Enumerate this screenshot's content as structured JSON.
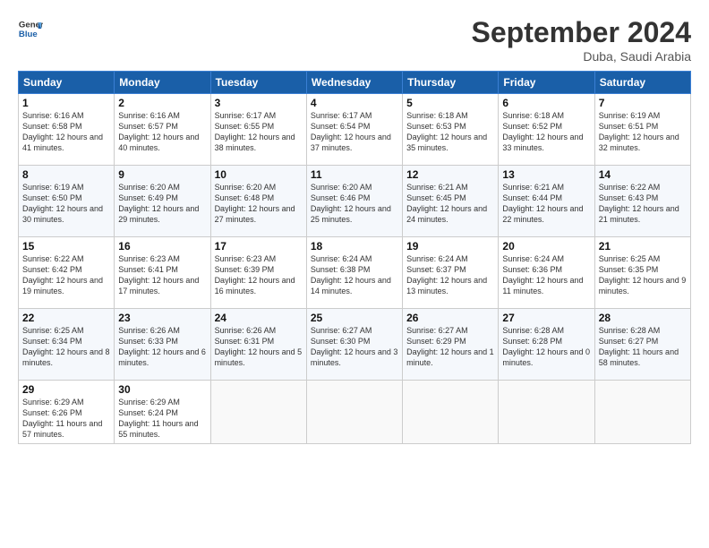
{
  "header": {
    "logo_line1": "General",
    "logo_line2": "Blue",
    "month": "September 2024",
    "location": "Duba, Saudi Arabia"
  },
  "days_of_week": [
    "Sunday",
    "Monday",
    "Tuesday",
    "Wednesday",
    "Thursday",
    "Friday",
    "Saturday"
  ],
  "weeks": [
    [
      {
        "day": "1",
        "sunrise": "6:16 AM",
        "sunset": "6:58 PM",
        "daylight": "12 hours and 41 minutes."
      },
      {
        "day": "2",
        "sunrise": "6:16 AM",
        "sunset": "6:57 PM",
        "daylight": "12 hours and 40 minutes."
      },
      {
        "day": "3",
        "sunrise": "6:17 AM",
        "sunset": "6:55 PM",
        "daylight": "12 hours and 38 minutes."
      },
      {
        "day": "4",
        "sunrise": "6:17 AM",
        "sunset": "6:54 PM",
        "daylight": "12 hours and 37 minutes."
      },
      {
        "day": "5",
        "sunrise": "6:18 AM",
        "sunset": "6:53 PM",
        "daylight": "12 hours and 35 minutes."
      },
      {
        "day": "6",
        "sunrise": "6:18 AM",
        "sunset": "6:52 PM",
        "daylight": "12 hours and 33 minutes."
      },
      {
        "day": "7",
        "sunrise": "6:19 AM",
        "sunset": "6:51 PM",
        "daylight": "12 hours and 32 minutes."
      }
    ],
    [
      {
        "day": "8",
        "sunrise": "6:19 AM",
        "sunset": "6:50 PM",
        "daylight": "12 hours and 30 minutes."
      },
      {
        "day": "9",
        "sunrise": "6:20 AM",
        "sunset": "6:49 PM",
        "daylight": "12 hours and 29 minutes."
      },
      {
        "day": "10",
        "sunrise": "6:20 AM",
        "sunset": "6:48 PM",
        "daylight": "12 hours and 27 minutes."
      },
      {
        "day": "11",
        "sunrise": "6:20 AM",
        "sunset": "6:46 PM",
        "daylight": "12 hours and 25 minutes."
      },
      {
        "day": "12",
        "sunrise": "6:21 AM",
        "sunset": "6:45 PM",
        "daylight": "12 hours and 24 minutes."
      },
      {
        "day": "13",
        "sunrise": "6:21 AM",
        "sunset": "6:44 PM",
        "daylight": "12 hours and 22 minutes."
      },
      {
        "day": "14",
        "sunrise": "6:22 AM",
        "sunset": "6:43 PM",
        "daylight": "12 hours and 21 minutes."
      }
    ],
    [
      {
        "day": "15",
        "sunrise": "6:22 AM",
        "sunset": "6:42 PM",
        "daylight": "12 hours and 19 minutes."
      },
      {
        "day": "16",
        "sunrise": "6:23 AM",
        "sunset": "6:41 PM",
        "daylight": "12 hours and 17 minutes."
      },
      {
        "day": "17",
        "sunrise": "6:23 AM",
        "sunset": "6:39 PM",
        "daylight": "12 hours and 16 minutes."
      },
      {
        "day": "18",
        "sunrise": "6:24 AM",
        "sunset": "6:38 PM",
        "daylight": "12 hours and 14 minutes."
      },
      {
        "day": "19",
        "sunrise": "6:24 AM",
        "sunset": "6:37 PM",
        "daylight": "12 hours and 13 minutes."
      },
      {
        "day": "20",
        "sunrise": "6:24 AM",
        "sunset": "6:36 PM",
        "daylight": "12 hours and 11 minutes."
      },
      {
        "day": "21",
        "sunrise": "6:25 AM",
        "sunset": "6:35 PM",
        "daylight": "12 hours and 9 minutes."
      }
    ],
    [
      {
        "day": "22",
        "sunrise": "6:25 AM",
        "sunset": "6:34 PM",
        "daylight": "12 hours and 8 minutes."
      },
      {
        "day": "23",
        "sunrise": "6:26 AM",
        "sunset": "6:33 PM",
        "daylight": "12 hours and 6 minutes."
      },
      {
        "day": "24",
        "sunrise": "6:26 AM",
        "sunset": "6:31 PM",
        "daylight": "12 hours and 5 minutes."
      },
      {
        "day": "25",
        "sunrise": "6:27 AM",
        "sunset": "6:30 PM",
        "daylight": "12 hours and 3 minutes."
      },
      {
        "day": "26",
        "sunrise": "6:27 AM",
        "sunset": "6:29 PM",
        "daylight": "12 hours and 1 minute."
      },
      {
        "day": "27",
        "sunrise": "6:28 AM",
        "sunset": "6:28 PM",
        "daylight": "12 hours and 0 minutes."
      },
      {
        "day": "28",
        "sunrise": "6:28 AM",
        "sunset": "6:27 PM",
        "daylight": "11 hours and 58 minutes."
      }
    ],
    [
      {
        "day": "29",
        "sunrise": "6:29 AM",
        "sunset": "6:26 PM",
        "daylight": "11 hours and 57 minutes."
      },
      {
        "day": "30",
        "sunrise": "6:29 AM",
        "sunset": "6:24 PM",
        "daylight": "11 hours and 55 minutes."
      },
      {
        "day": "",
        "sunrise": "",
        "sunset": "",
        "daylight": ""
      },
      {
        "day": "",
        "sunrise": "",
        "sunset": "",
        "daylight": ""
      },
      {
        "day": "",
        "sunrise": "",
        "sunset": "",
        "daylight": ""
      },
      {
        "day": "",
        "sunrise": "",
        "sunset": "",
        "daylight": ""
      },
      {
        "day": "",
        "sunrise": "",
        "sunset": "",
        "daylight": ""
      }
    ]
  ]
}
